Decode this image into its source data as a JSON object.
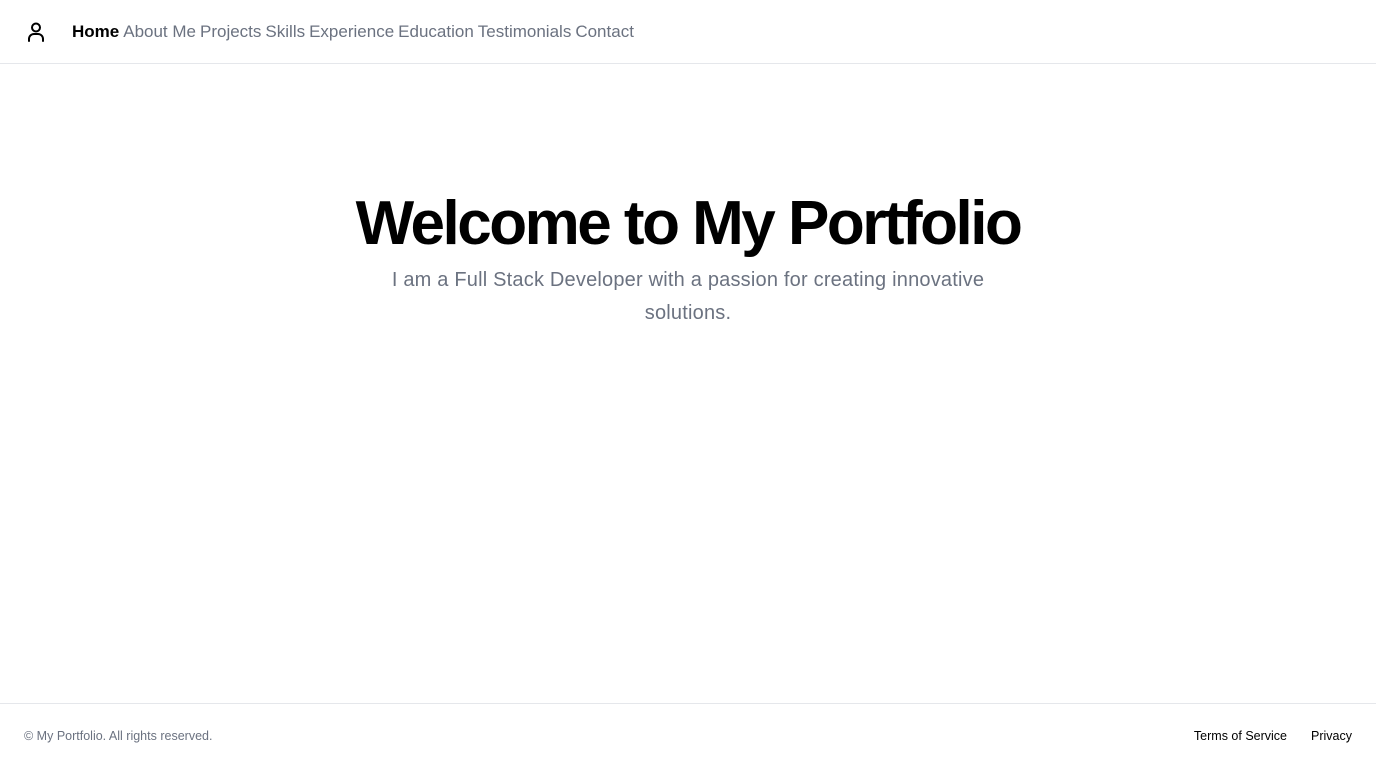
{
  "header": {
    "logo_icon": "user-icon",
    "nav": [
      {
        "label": "Home",
        "active": true
      },
      {
        "label": "About Me",
        "active": false
      },
      {
        "label": "Projects",
        "active": false
      },
      {
        "label": "Skills",
        "active": false
      },
      {
        "label": "Experience",
        "active": false
      },
      {
        "label": "Education",
        "active": false
      },
      {
        "label": "Testimonials",
        "active": false
      },
      {
        "label": "Contact",
        "active": false
      }
    ]
  },
  "hero": {
    "title": "Welcome to My Portfolio",
    "subtitle": "I am a Full Stack Developer with a passion for creating innovative solutions."
  },
  "footer": {
    "copyright": "© My Portfolio. All rights reserved.",
    "links": [
      {
        "label": "Terms of Service"
      },
      {
        "label": "Privacy"
      }
    ]
  },
  "colors": {
    "text_primary": "#000000",
    "text_muted": "#6b7280",
    "border": "#e5e7eb",
    "background": "#ffffff"
  }
}
